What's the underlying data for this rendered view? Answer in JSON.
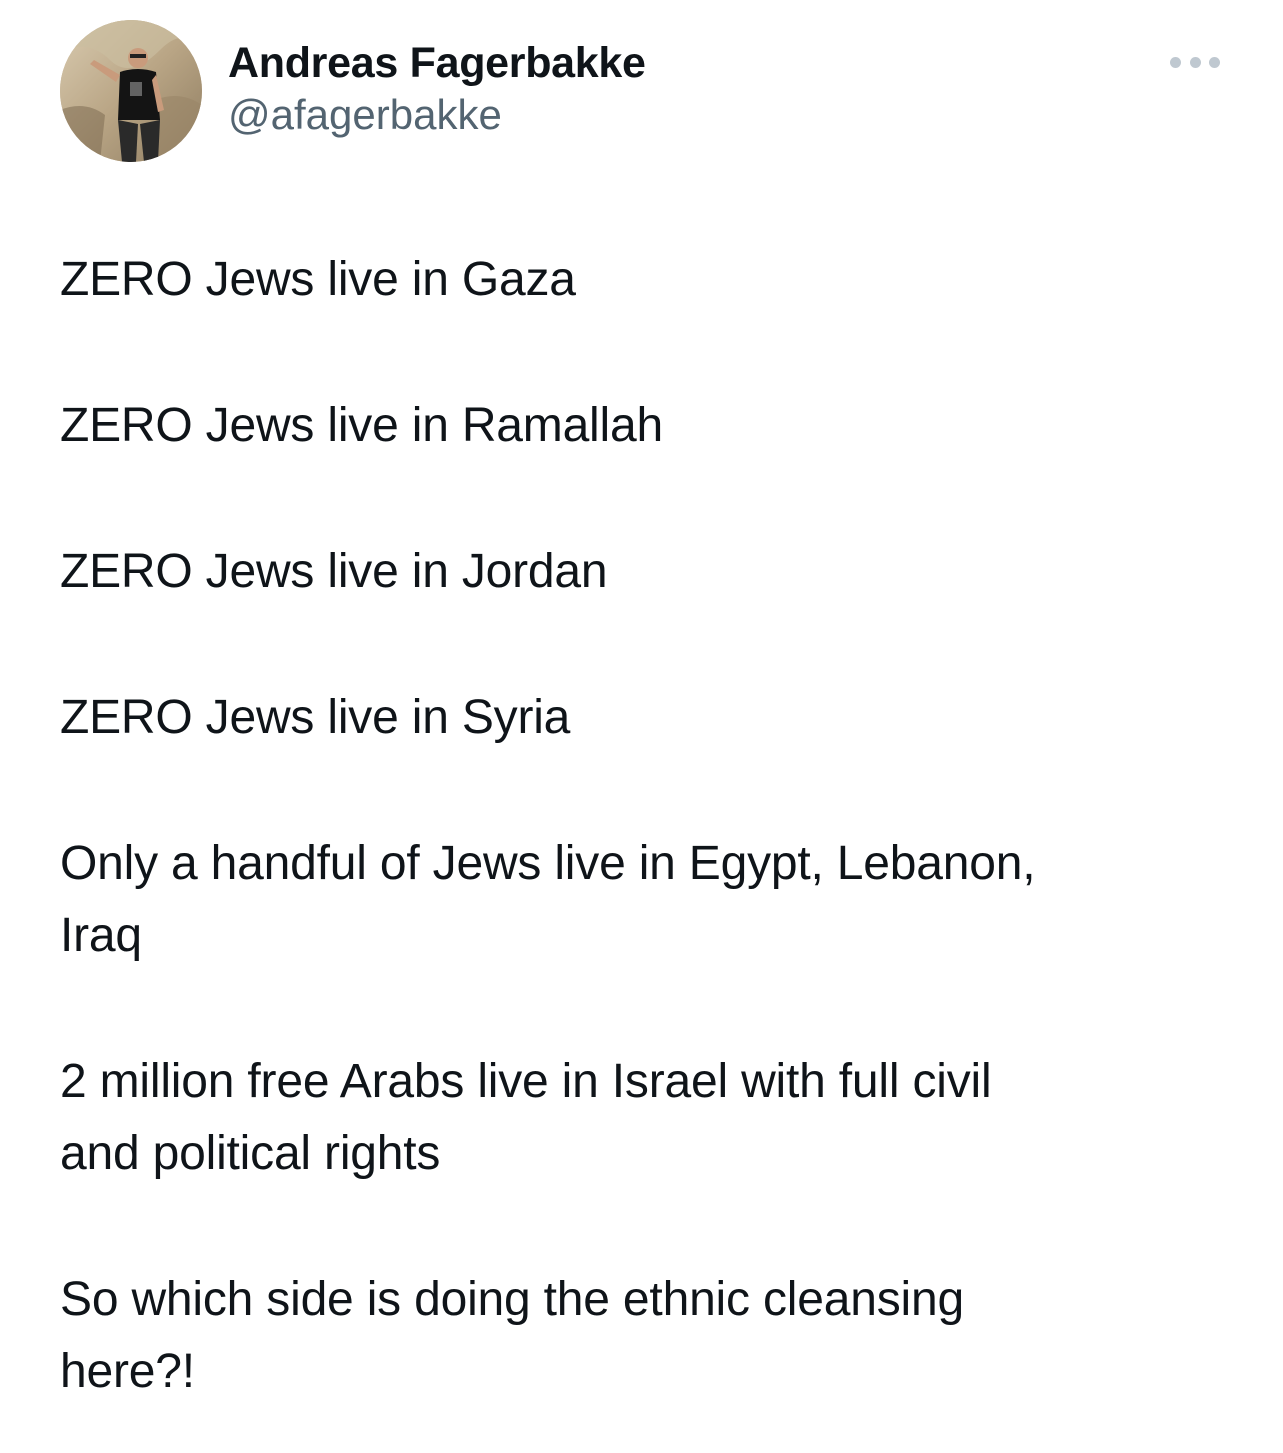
{
  "author": {
    "display_name": "Andreas Fagerbakke",
    "handle": "@afagerbakke",
    "avatar_icon": "profile-photo"
  },
  "menu": {
    "icon": "more-options-icon"
  },
  "tweet": {
    "paragraphs": [
      "ZERO Jews live in Gaza",
      "ZERO Jews live in Ramallah",
      "ZERO Jews live in Jordan",
      "ZERO Jews live in Syria",
      "Only a handful of Jews live in Egypt, Lebanon,\nIraq",
      "2 million free Arabs live in Israel with full civil\nand political rights",
      "So which side is doing the ethnic cleansing\nhere?!"
    ]
  },
  "colors": {
    "text_primary": "#0f1419",
    "text_secondary": "#536471",
    "menu_dots": "#bfc8d0",
    "background": "#ffffff"
  }
}
